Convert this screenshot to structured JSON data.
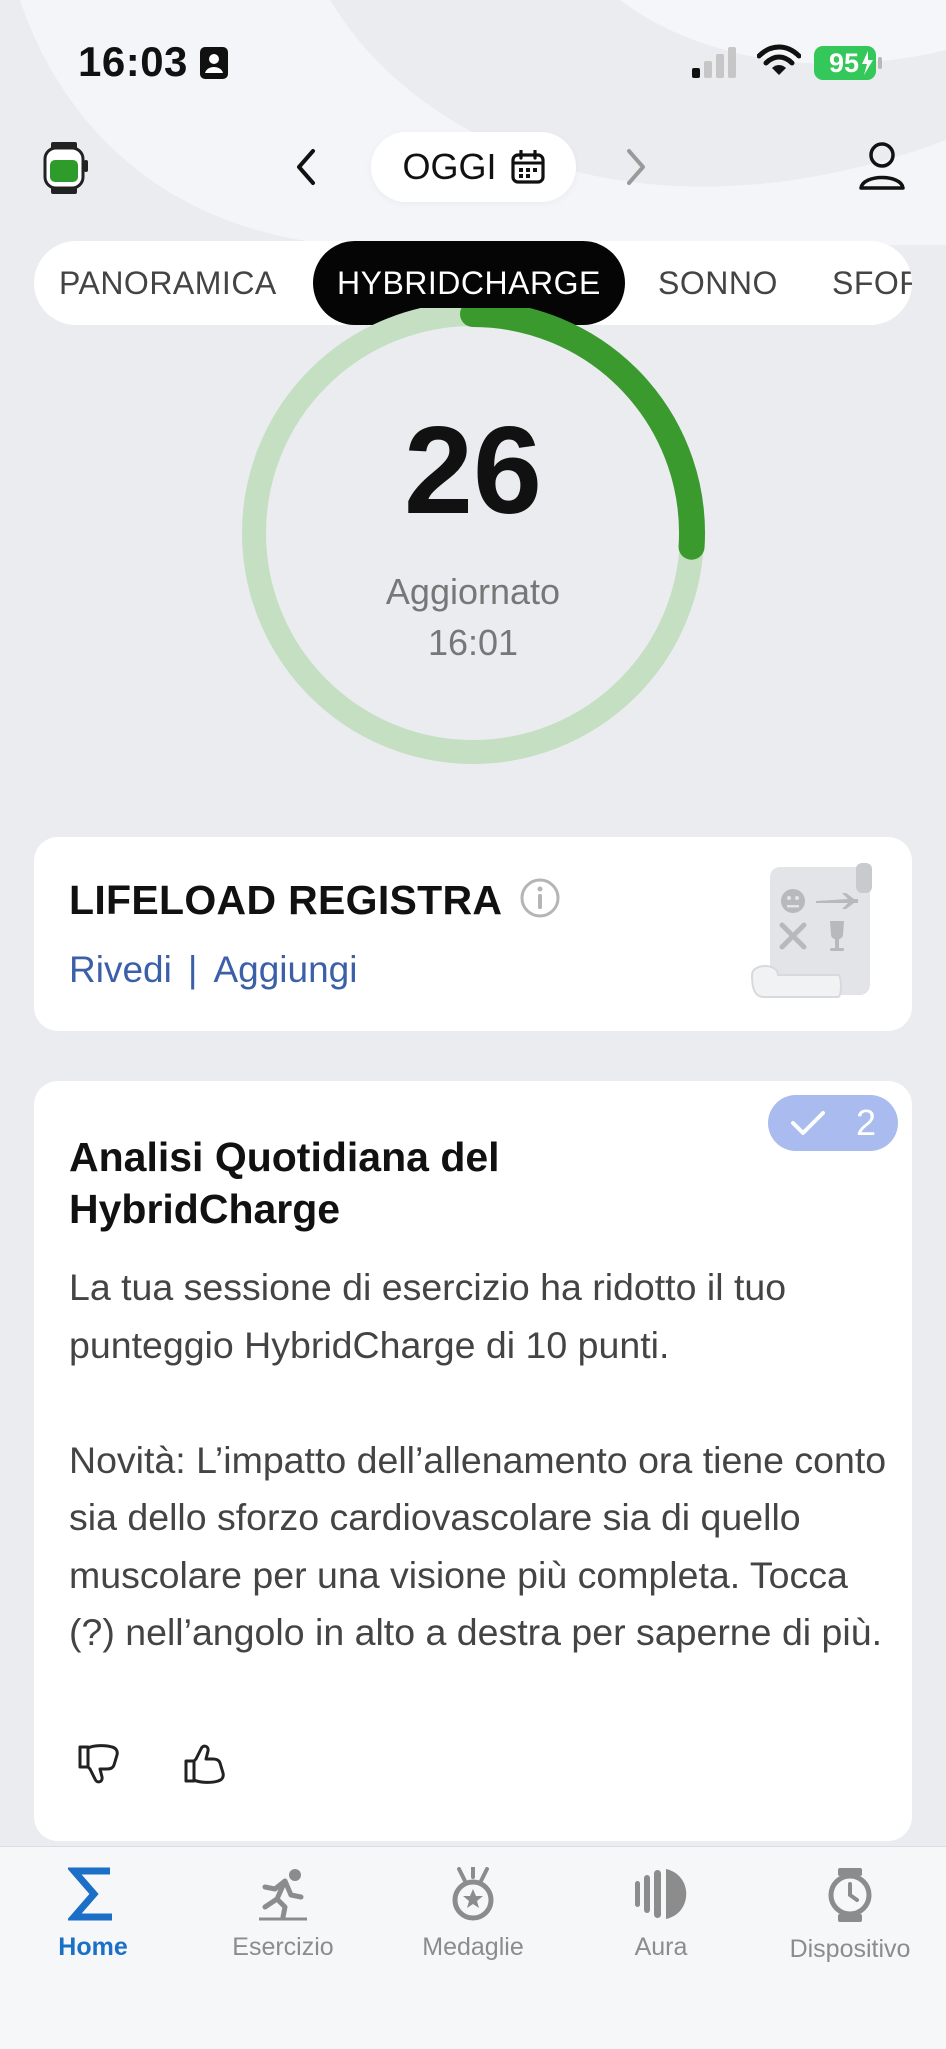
{
  "status_bar": {
    "time": "16:03",
    "battery": "95",
    "icons": [
      "id-card-icon",
      "cellular-signal-icon",
      "wifi-icon",
      "battery-charging-icon"
    ]
  },
  "header": {
    "date_label": "OGGI",
    "icons": [
      "watch-icon",
      "chevron-left-icon",
      "calendar-icon",
      "chevron-right-icon",
      "profile-icon"
    ]
  },
  "tabs": [
    {
      "label": "PANORAMICA",
      "active": false
    },
    {
      "label": "HYBRIDCHARGE",
      "active": true
    },
    {
      "label": "SONNO",
      "active": false
    },
    {
      "label": "SFOR",
      "active": false
    }
  ],
  "gauge": {
    "score": "26",
    "value_fraction": 0.26,
    "updated_label": "Aggiornato",
    "updated_time": "16:01",
    "colors": {
      "fill": "#3a9a2e",
      "track": "#c5dfc3"
    }
  },
  "lifeload": {
    "title": "LIFELOAD REGISTRA",
    "review_link": "Rivedi",
    "separator": "|",
    "add_link": "Aggiungi",
    "icons": [
      "info-icon",
      "scroll-illustration"
    ]
  },
  "analysis": {
    "badge_count": "2",
    "title": "Analisi Quotidiana del HybridCharge",
    "paragraph1": "La tua sessione di esercizio ha ridotto il tuo punteggio HybridCharge di 10 punti.",
    "paragraph2": "Novità: L’impatto dell’allenamento ora tiene conto sia dello sforzo cardiovascolare sia di quello muscolare per una visione più completa. Tocca (?) nell’angolo in alto a destra per saperne di più.",
    "icons": [
      "check-icon",
      "thumbs-down-icon",
      "thumbs-up-icon"
    ]
  },
  "bottom_nav": [
    {
      "label": "Home",
      "icon": "sigma-icon",
      "active": true
    },
    {
      "label": "Esercizio",
      "icon": "runner-icon",
      "active": false
    },
    {
      "label": "Medaglie",
      "icon": "medal-icon",
      "active": false
    },
    {
      "label": "Aura",
      "icon": "aura-icon",
      "active": false
    },
    {
      "label": "Dispositivo",
      "icon": "watch-device-icon",
      "active": false
    }
  ],
  "colors": {
    "accent": "#1b6fc7",
    "link": "#3b5fa8",
    "badge": "#a9bbef"
  }
}
